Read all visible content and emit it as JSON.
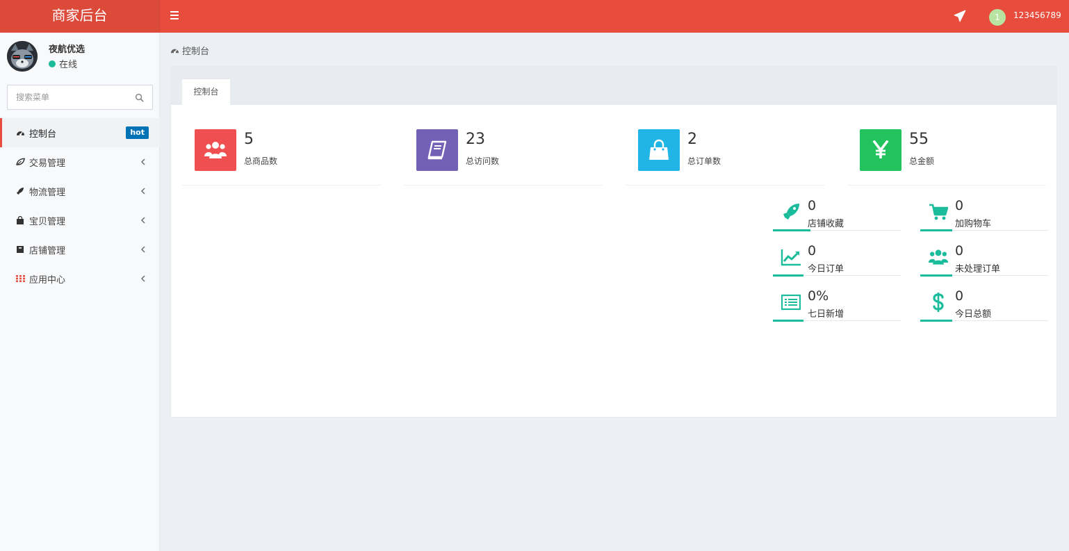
{
  "header": {
    "brand": "商家后台",
    "user_badge": "1",
    "user_name": "123456789"
  },
  "sidebar": {
    "profile": {
      "name": "夜航优选",
      "status": "在线"
    },
    "search_placeholder": "搜索菜单",
    "items": [
      {
        "label": "控制台",
        "badge": "hot",
        "icon": "dashboard-icon"
      },
      {
        "label": "交易管理",
        "icon": "leaf-icon"
      },
      {
        "label": "物流管理",
        "icon": "rocket-icon"
      },
      {
        "label": "宝贝管理",
        "icon": "shopping-bag-icon"
      },
      {
        "label": "店铺管理",
        "icon": "archive-icon"
      },
      {
        "label": "应用中心",
        "icon": "grid-icon"
      }
    ]
  },
  "breadcrumb": {
    "label": "控制台"
  },
  "panel": {
    "tab": "控制台"
  },
  "stats": [
    {
      "value": "5",
      "label": "总商品数",
      "color": "#f04f51",
      "icon": "users-icon"
    },
    {
      "value": "23",
      "label": "总访问数",
      "color": "#7361b5",
      "icon": "book-icon"
    },
    {
      "value": "2",
      "label": "总订单数",
      "color": "#20b5e4",
      "icon": "shopping-bag-icon"
    },
    {
      "value": "55",
      "label": "总金额",
      "color": "#22c35e",
      "icon": "yen-icon"
    }
  ],
  "mini_stats": [
    {
      "value": "0",
      "label": "店铺收藏",
      "icon": "rocket-icon"
    },
    {
      "value": "0",
      "label": "加购物车",
      "icon": "cart-icon"
    },
    {
      "value": "0",
      "label": "今日订单",
      "icon": "line-chart-icon"
    },
    {
      "value": "0",
      "label": "未处理订单",
      "icon": "users-icon"
    },
    {
      "value": "0%",
      "label": "七日新增",
      "icon": "list-icon"
    },
    {
      "value": "0",
      "label": "今日总额",
      "icon": "dollar-icon"
    }
  ],
  "colors": {
    "header": "#e74c3c",
    "accent": "#1abc9c",
    "hot_badge": "#0073b7"
  }
}
